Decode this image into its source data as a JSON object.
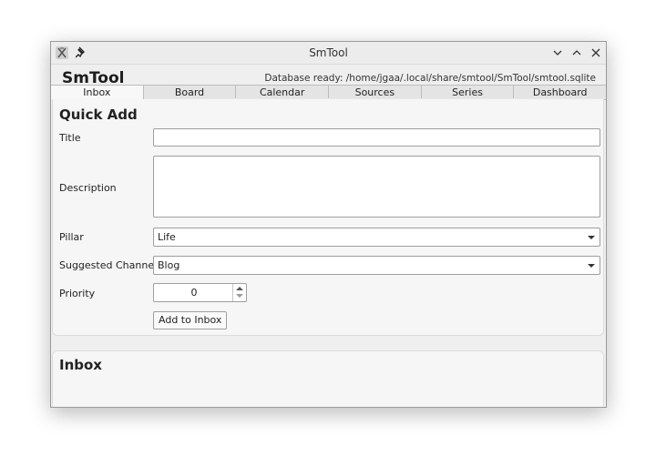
{
  "window": {
    "title": "SmTool",
    "icons": {
      "app": "app-icon",
      "pin": "pin-icon",
      "minimize": "chevron-down-icon",
      "maximize": "chevron-up-icon",
      "close": "close-icon"
    }
  },
  "header": {
    "title": "SmTool",
    "status": "Database ready: /home/jgaa/.local/share/smtool/SmTool/smtool.sqlite"
  },
  "tabs": [
    {
      "label": "Inbox",
      "active": true
    },
    {
      "label": "Board",
      "active": false
    },
    {
      "label": "Calendar",
      "active": false
    },
    {
      "label": "Sources",
      "active": false
    },
    {
      "label": "Series",
      "active": false
    },
    {
      "label": "Dashboard",
      "active": false
    }
  ],
  "quick_add": {
    "title": "Quick Add",
    "fields": {
      "title_label": "Title",
      "title_value": "",
      "description_label": "Description",
      "description_value": "",
      "pillar_label": "Pillar",
      "pillar_value": "Life",
      "channel_label": "Suggested Channel",
      "channel_value": "Blog",
      "priority_label": "Priority",
      "priority_value": "0"
    },
    "add_button": "Add to Inbox"
  },
  "inbox": {
    "title": "Inbox"
  }
}
